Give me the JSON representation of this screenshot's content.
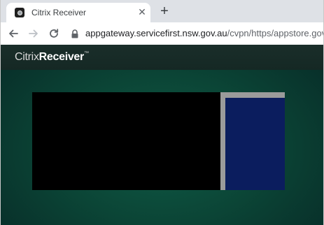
{
  "browser": {
    "tab": {
      "title": "Citrix Receiver",
      "favicon": "citrix-favicon-icon",
      "close_icon": "close-icon"
    },
    "new_tab_icon": "plus-icon",
    "toolbar": {
      "back_icon": "arrow-left-icon",
      "forward_icon": "arrow-right-icon",
      "reload_icon": "reload-icon",
      "lock_icon": "lock-icon",
      "url_host": "appgateway.servicefirst.nsw.gov.au",
      "url_path": "/cvpn/https/appstore.govnet.n"
    }
  },
  "page": {
    "logo_brand": "Citrix",
    "logo_product": "Receiver",
    "logo_tm": "™"
  },
  "colors": {
    "background_green": "#0b4536",
    "panel_black": "#000000",
    "frame_gray": "#9b9b9b",
    "panel_blue": "#0b1d5e"
  }
}
